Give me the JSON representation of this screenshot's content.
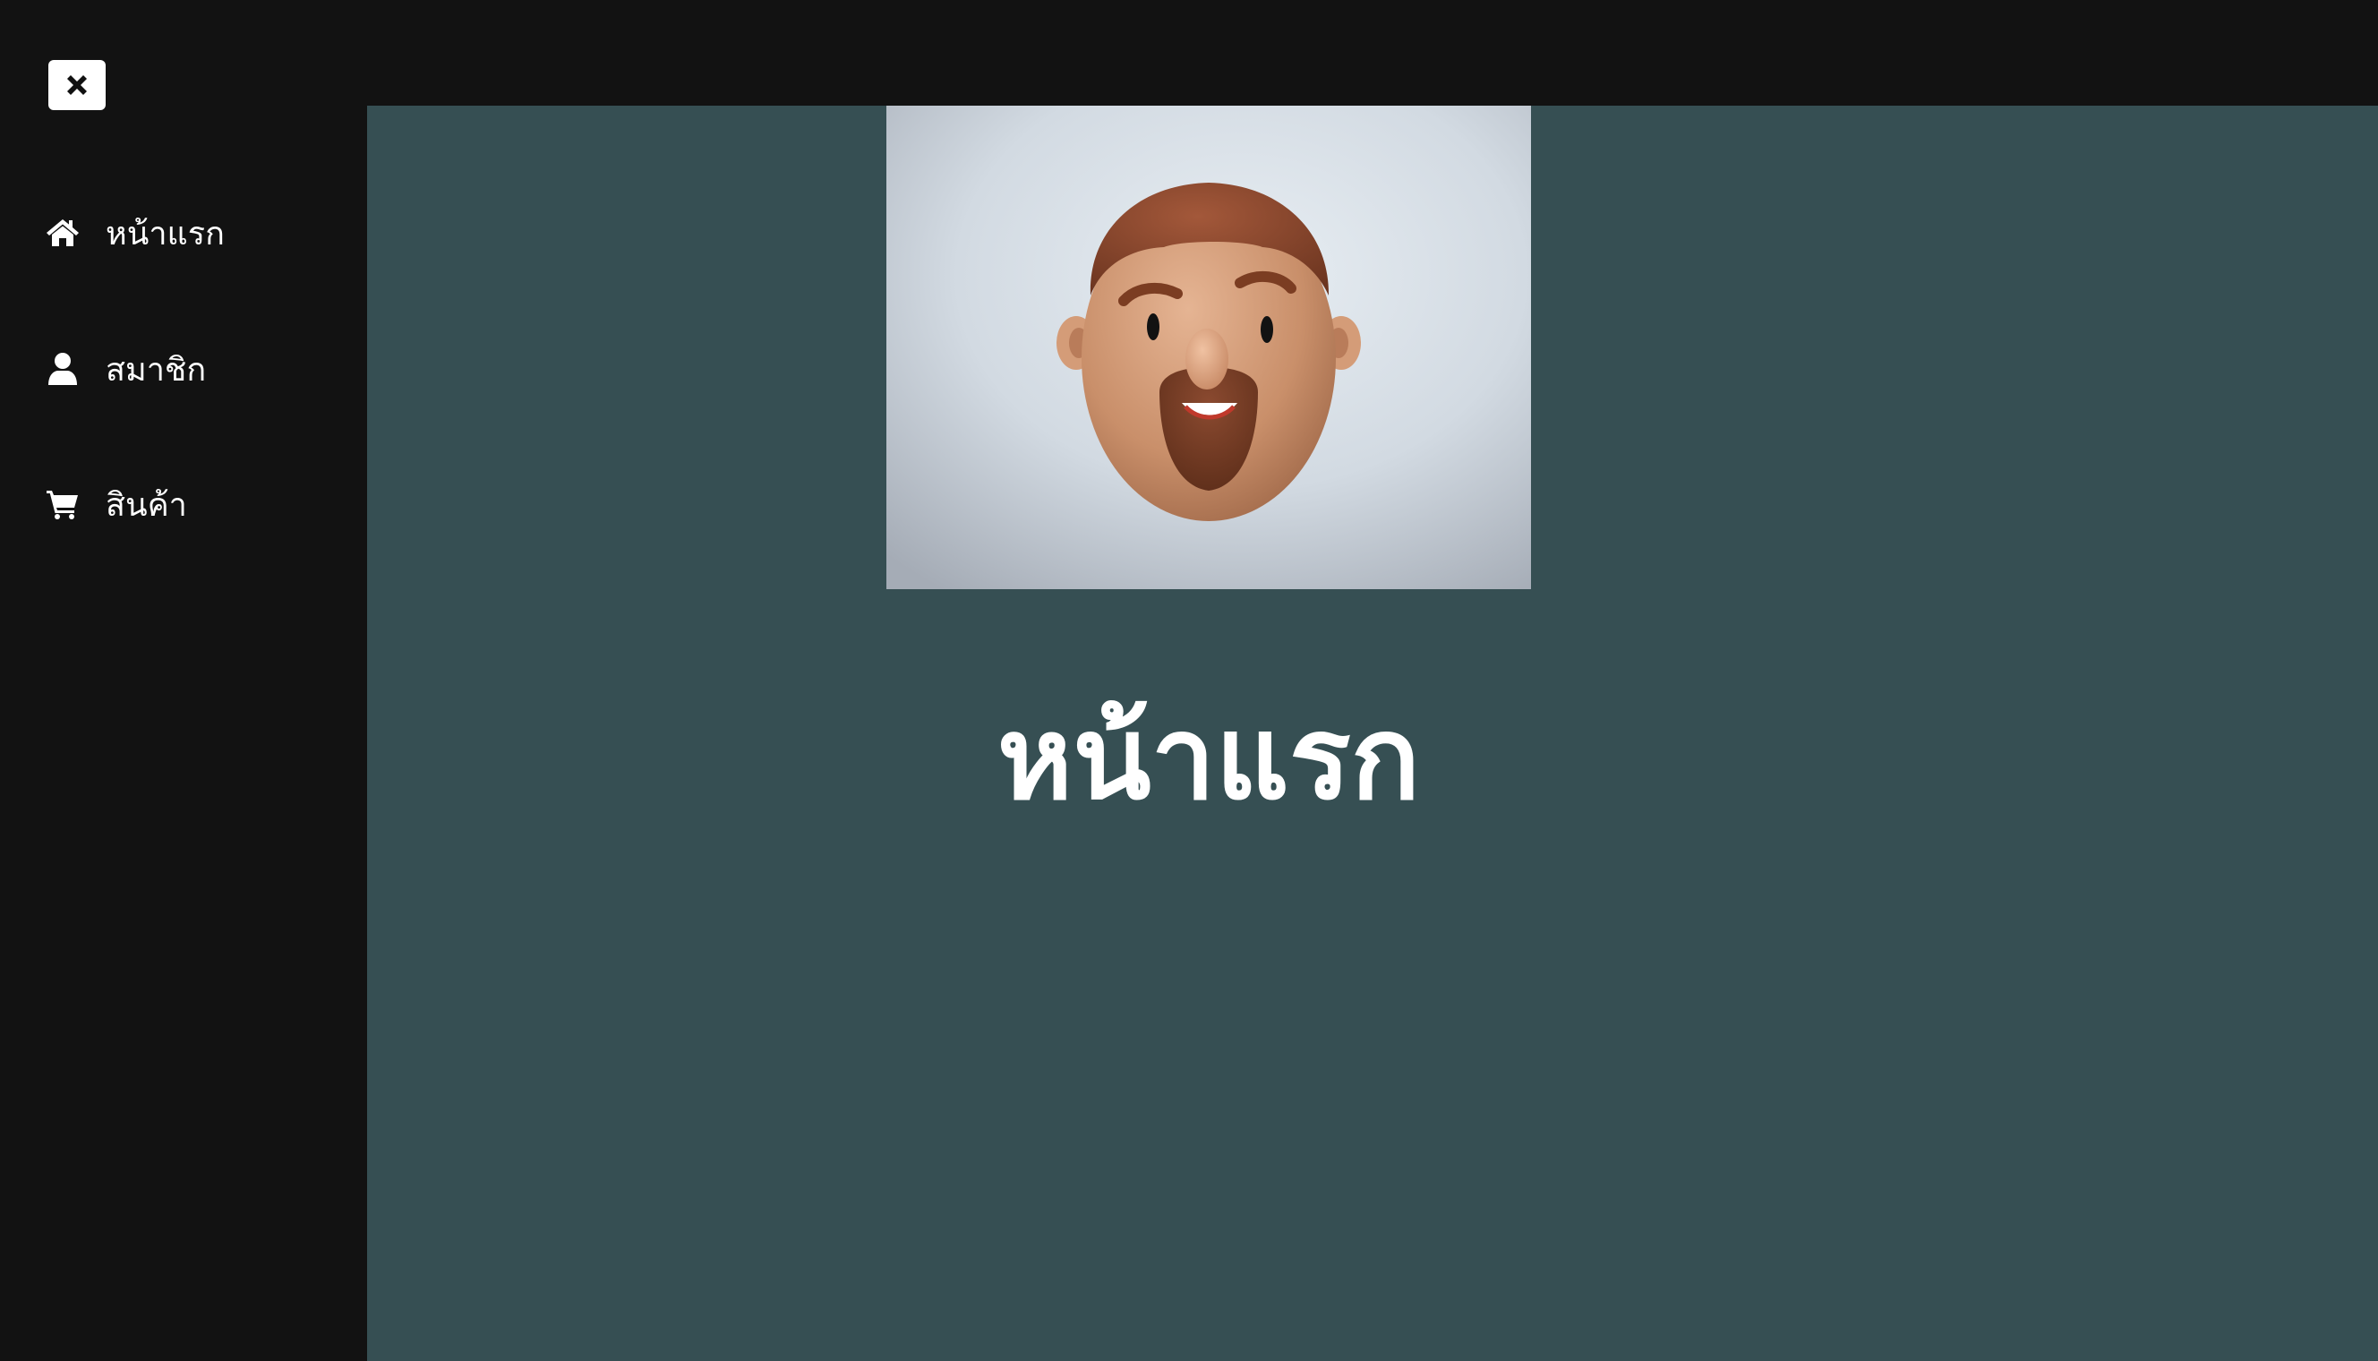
{
  "sidebar": {
    "close_icon": "close-x-icon",
    "items": [
      {
        "label": "หน้าแรก",
        "icon": "home-icon"
      },
      {
        "label": "สมาชิก",
        "icon": "user-icon"
      },
      {
        "label": "สินค้า",
        "icon": "cart-icon"
      }
    ]
  },
  "main": {
    "title": "หน้าแรก",
    "image": "avatar-3d-face"
  },
  "colors": {
    "sidebar_bg": "#121212",
    "main_bg": "#364f53",
    "text": "#ffffff"
  }
}
